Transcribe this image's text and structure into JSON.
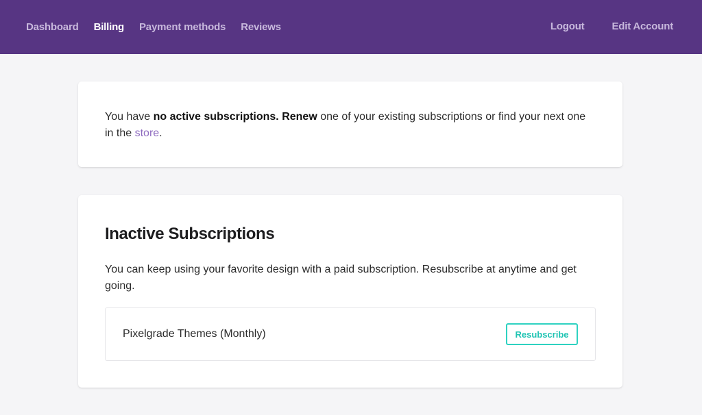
{
  "nav": {
    "left": [
      {
        "label": "Dashboard"
      },
      {
        "label": "Billing"
      },
      {
        "label": "Payment methods"
      },
      {
        "label": "Reviews"
      }
    ],
    "right": [
      {
        "label": "Logout"
      },
      {
        "label": "Edit Account"
      }
    ]
  },
  "notice": {
    "text_before": "You have ",
    "bold_1": "no active subscriptions.",
    "space": " ",
    "bold_2": "Renew",
    "text_middle": " one of your existing subscriptions or find your next one in the ",
    "link": "store",
    "text_after": "."
  },
  "inactive": {
    "title": "Inactive Subscriptions",
    "description": "You can keep using your favorite design with a paid subscription. Resubscribe at anytime and get going.",
    "subscriptions": [
      {
        "name": "Pixelgrade Themes (Monthly)",
        "action_label": "Resubscribe"
      }
    ]
  },
  "colors": {
    "header_bg": "#573583",
    "accent_teal": "#2ed2c1",
    "link_purple": "#8e6bbf"
  }
}
